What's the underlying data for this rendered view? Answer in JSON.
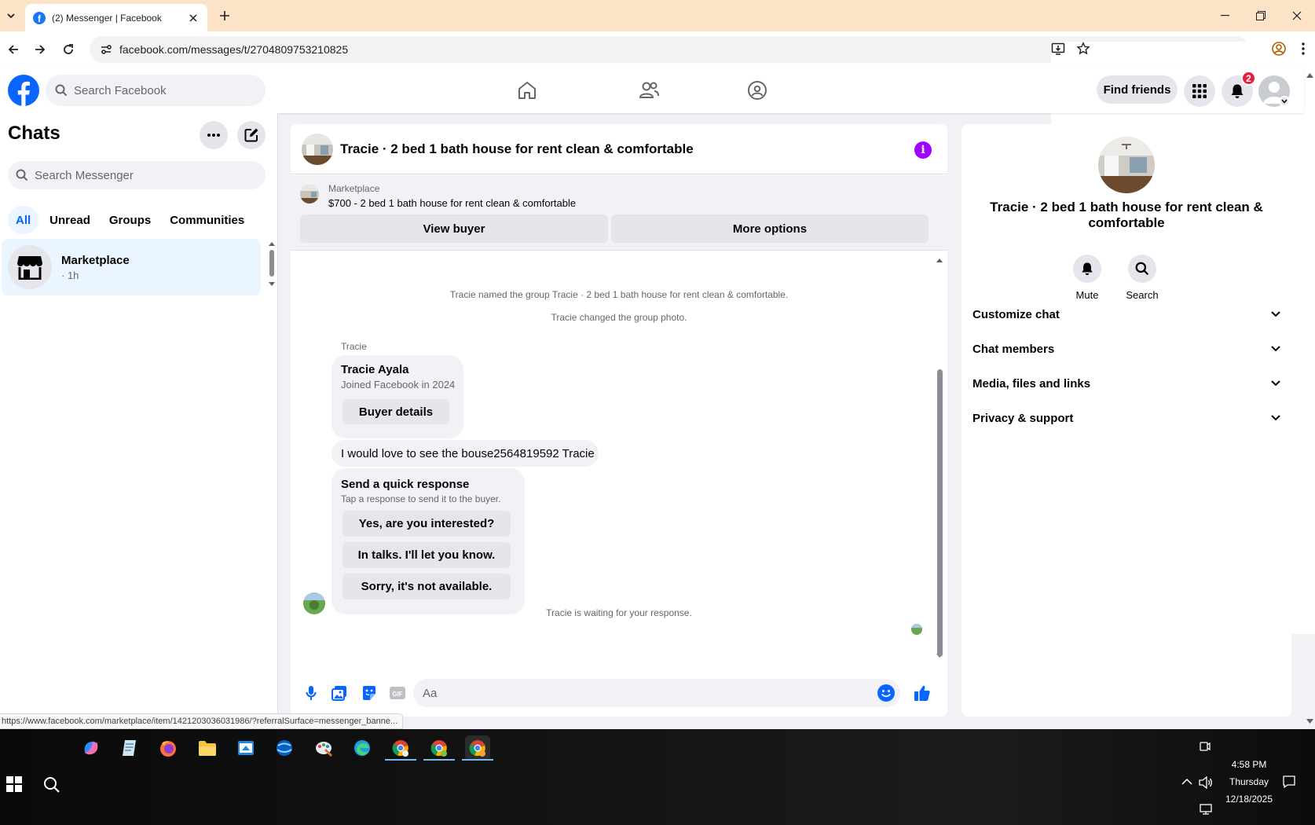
{
  "browser": {
    "tab_title": "(2) Messenger | Facebook",
    "url": "facebook.com/messages/t/2704809753210825",
    "status_url": "https://www.facebook.com/marketplace/item/1421203036031986/?referralSurface=messenger_banne..."
  },
  "fb_top": {
    "search_placeholder": "Search Facebook",
    "find_friends": "Find friends",
    "notification_count": "2"
  },
  "chats": {
    "title": "Chats",
    "search_placeholder": "Search Messenger",
    "filters": [
      "All",
      "Unread",
      "Groups",
      "Communities"
    ],
    "items": [
      {
        "name": "Marketplace",
        "sub": "· 1h"
      }
    ]
  },
  "conversation": {
    "title": "Tracie · 2 bed 1 bath house for rent clean & comfortable",
    "marketplace_label": "Marketplace",
    "listing": "$700 - 2 bed 1 bath house for rent clean & comfortable",
    "view_buyer": "View buyer",
    "more_options": "More options",
    "system_1": "Tracie named the group Tracie · 2 bed 1 bath house for rent clean & comfortable.",
    "system_2": "Tracie changed the group photo.",
    "sender": "Tracie",
    "card_name": "Tracie Ayala",
    "card_sub": "Joined Facebook in 2024",
    "buyer_details": "Buyer details",
    "message": "I would love to see the bouse2564819592 Tracie",
    "quick_title": "Send a quick response",
    "quick_sub": "Tap a response to send it to the buyer.",
    "quick_responses": [
      "Yes, are you interested?",
      "In talks. I'll let you know.",
      "Sorry, it's not available."
    ],
    "waiting": "Tracie is waiting for your response.",
    "composer_placeholder": "Aa"
  },
  "info_panel": {
    "title": "Tracie · 2 bed 1 bath house for rent clean & comfortable",
    "mute": "Mute",
    "search": "Search",
    "sections": [
      "Customize chat",
      "Chat members",
      "Media, files and links",
      "Privacy & support"
    ]
  },
  "taskbar": {
    "time": "4:58 PM",
    "day": "Thursday",
    "date": "12/18/2025"
  },
  "colors": {
    "fb_blue": "#0866ff",
    "messenger_purple": "#a200ff",
    "badge_red": "#e41e3f",
    "tab_strip": "#fce3c8"
  }
}
